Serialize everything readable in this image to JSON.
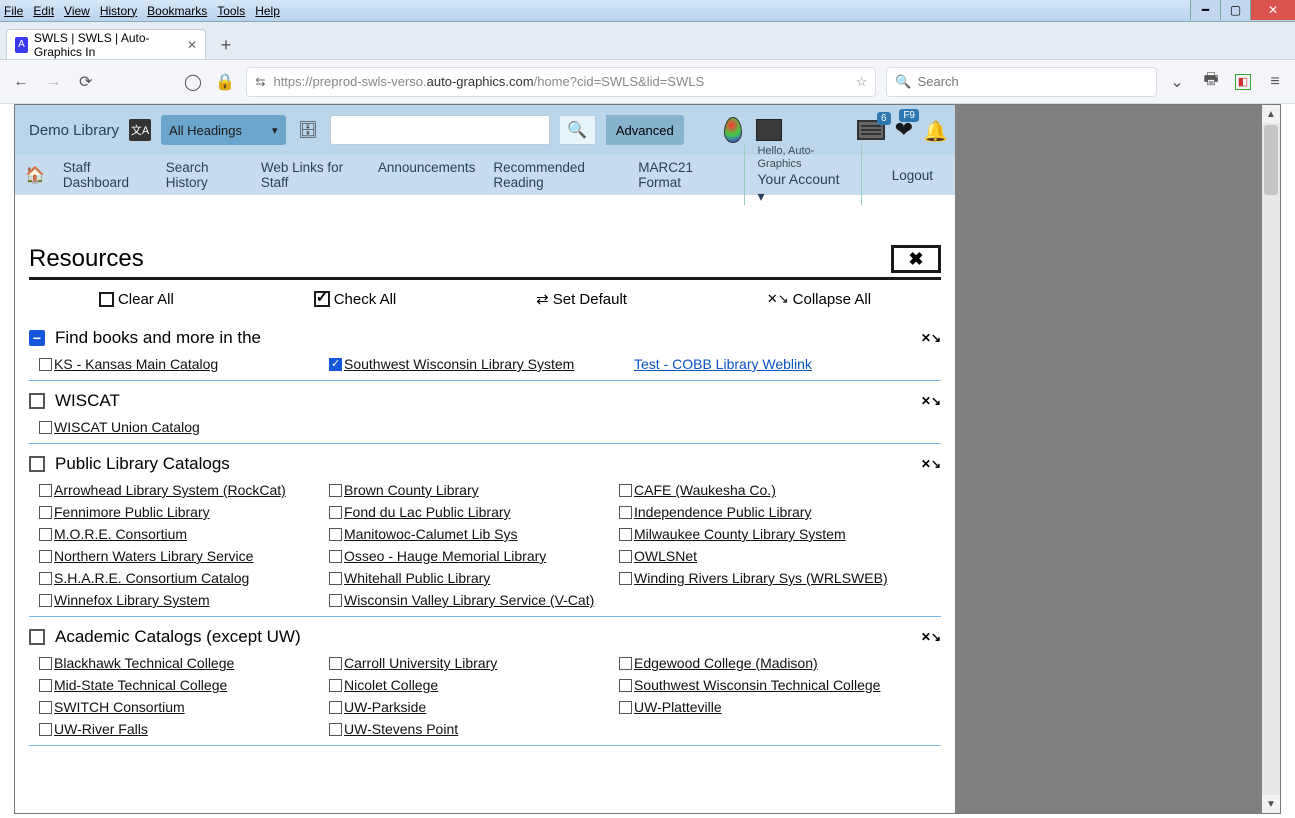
{
  "os_menu": [
    "File",
    "Edit",
    "View",
    "History",
    "Bookmarks",
    "Tools",
    "Help"
  ],
  "tab": {
    "title": "SWLS | SWLS | Auto-Graphics In"
  },
  "url": {
    "scheme": "https://",
    "sub": "preprod-swls-verso.",
    "host": "auto-graphics.com",
    "path": "/home?cid=SWLS&lid=SWLS"
  },
  "browser_search_placeholder": "Search",
  "library_name": "Demo Library",
  "headings_label": "All Headings",
  "advanced_label": "Advanced",
  "badges": {
    "cards": "6",
    "heart": "F9"
  },
  "account": {
    "hello": "Hello, Auto-Graphics",
    "label": "Your Account",
    "logout": "Logout"
  },
  "nav_items": [
    "Staff Dashboard",
    "Search History",
    "Web Links for Staff",
    "Announcements",
    "Recommended Reading",
    "MARC21 Format"
  ],
  "panel_title": "Resources",
  "actions": {
    "clear": "Clear All",
    "check": "Check All",
    "default": "Set Default",
    "collapse": "Collapse All"
  },
  "groups": [
    {
      "head_style": "minus",
      "title": "Find books and more in the",
      "items": [
        {
          "checked": false,
          "label": "KS - Kansas Main Catalog"
        },
        {
          "checked": true,
          "label": "Southwest Wisconsin Library System"
        },
        {
          "checked": null,
          "label": "Test - COBB Library Weblink",
          "blue": true
        }
      ]
    },
    {
      "head_style": "box",
      "title": "WISCAT",
      "items": [
        {
          "checked": false,
          "label": "WISCAT Union Catalog"
        }
      ]
    },
    {
      "head_style": "box",
      "title": "Public Library Catalogs",
      "items": [
        {
          "checked": false,
          "label": "Arrowhead Library System (RockCat)"
        },
        {
          "checked": false,
          "label": "Brown County Library"
        },
        {
          "checked": false,
          "label": "CAFE (Waukesha Co.)"
        },
        {
          "checked": false,
          "label": "Fennimore Public Library"
        },
        {
          "checked": false,
          "label": "Fond du Lac Public Library"
        },
        {
          "checked": false,
          "label": "Independence Public Library"
        },
        {
          "checked": false,
          "label": "M.O.R.E. Consortium"
        },
        {
          "checked": false,
          "label": "Manitowoc-Calumet Lib Sys"
        },
        {
          "checked": false,
          "label": "Milwaukee County Library System"
        },
        {
          "checked": false,
          "label": "Northern Waters Library Service"
        },
        {
          "checked": false,
          "label": "Osseo - Hauge Memorial Library"
        },
        {
          "checked": false,
          "label": "OWLSNet"
        },
        {
          "checked": false,
          "label": "S.H.A.R.E. Consortium Catalog"
        },
        {
          "checked": false,
          "label": "Whitehall Public Library"
        },
        {
          "checked": false,
          "label": "Winding Rivers Library Sys (WRLSWEB)"
        },
        {
          "checked": false,
          "label": "Winnefox Library System"
        },
        {
          "checked": false,
          "label": "Wisconsin Valley Library Service (V-Cat)"
        }
      ]
    },
    {
      "head_style": "box",
      "title": "Academic Catalogs (except UW)",
      "items": [
        {
          "checked": false,
          "label": "Blackhawk Technical College"
        },
        {
          "checked": false,
          "label": "Carroll University Library"
        },
        {
          "checked": false,
          "label": "Edgewood College (Madison)"
        },
        {
          "checked": false,
          "label": "Mid-State Technical College"
        },
        {
          "checked": false,
          "label": "Nicolet College"
        },
        {
          "checked": false,
          "label": "Southwest Wisconsin Technical College"
        },
        {
          "checked": false,
          "label": "SWITCH Consortium"
        },
        {
          "checked": false,
          "label": "UW-Parkside"
        },
        {
          "checked": false,
          "label": "UW-Platteville"
        },
        {
          "checked": false,
          "label": "UW-River Falls"
        },
        {
          "checked": false,
          "label": "UW-Stevens Point"
        }
      ]
    }
  ]
}
